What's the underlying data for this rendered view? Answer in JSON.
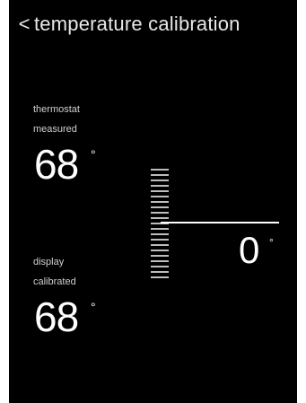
{
  "header": {
    "back_icon": "chevron-left-icon",
    "back_glyph": "<",
    "title": "temperature calibration"
  },
  "thermostat": {
    "label_line1": "thermostat",
    "label_line2": "measured",
    "value": "68",
    "degree": "°"
  },
  "display": {
    "label_line1": "display",
    "label_line2": "calibrated",
    "value": "68",
    "degree": "°"
  },
  "offset": {
    "value": "0",
    "degree": "°"
  },
  "colors": {
    "background": "#000000",
    "text": "#ffffff",
    "tick": "#bdbdbd"
  }
}
